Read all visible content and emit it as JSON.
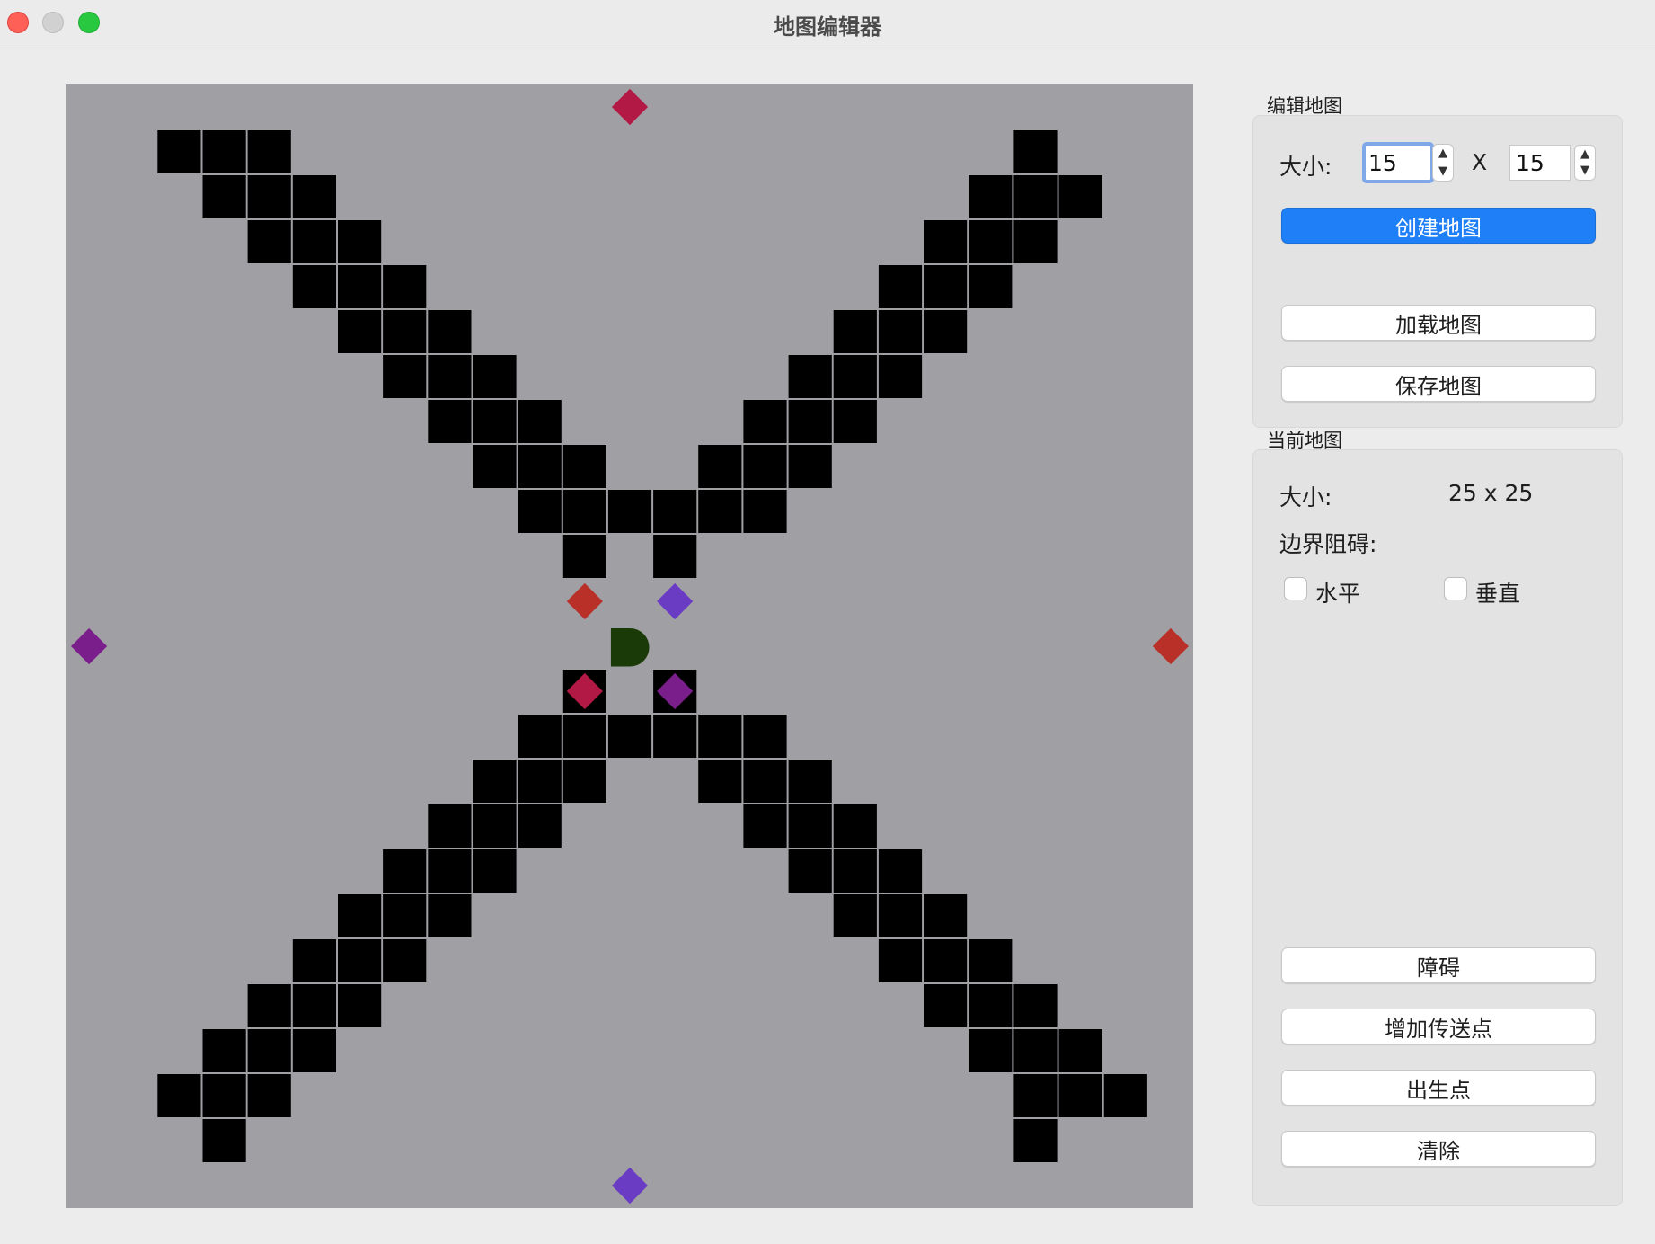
{
  "window": {
    "title": "地图编辑器"
  },
  "edit_group": {
    "label": "编辑地图",
    "size_label": "大小:",
    "width_value": "15",
    "height_value": "15",
    "separator": "X",
    "create_button": "创建地图",
    "load_button": "加载地图",
    "save_button": "保存地图"
  },
  "current_group": {
    "label": "当前地图",
    "size_label": "大小:",
    "size_value": "25 x 25",
    "border_label": "边界阻碍:",
    "horizontal_label": "水平",
    "vertical_label": "垂直",
    "horizontal_checked": false,
    "vertical_checked": false
  },
  "tools": {
    "obstacle_button": "障碍",
    "teleport_button": "增加传送点",
    "spawn_button": "出生点",
    "clear_button": "清除"
  },
  "colors": {
    "board_background": "#a09fa4",
    "obstacle": "#000000",
    "spawn": "#1a3a08",
    "teleport_crimson": "#b21a45",
    "teleport_red": "#b83028",
    "teleport_purple": "#7a1e8c",
    "teleport_violet": "#6a3cc4",
    "accent": "#1f7ff6"
  },
  "map": {
    "grid_size": 25,
    "obstacles": [
      [
        2,
        3
      ],
      [
        1,
        2
      ],
      [
        1,
        3
      ],
      [
        1,
        4
      ],
      [
        2,
        3
      ],
      [
        2,
        4
      ],
      [
        2,
        5
      ],
      [
        3,
        4
      ],
      [
        3,
        5
      ],
      [
        3,
        6
      ],
      [
        4,
        5
      ],
      [
        4,
        6
      ],
      [
        4,
        7
      ],
      [
        5,
        6
      ],
      [
        5,
        7
      ],
      [
        5,
        8
      ],
      [
        6,
        7
      ],
      [
        6,
        8
      ],
      [
        6,
        9
      ],
      [
        7,
        8
      ],
      [
        7,
        9
      ],
      [
        7,
        10
      ],
      [
        8,
        9
      ],
      [
        8,
        10
      ],
      [
        8,
        11
      ],
      [
        9,
        10
      ],
      [
        9,
        11
      ],
      [
        9,
        12
      ],
      [
        10,
        11
      ],
      [
        1,
        21
      ],
      [
        2,
        20
      ],
      [
        2,
        21
      ],
      [
        2,
        22
      ],
      [
        3,
        19
      ],
      [
        3,
        20
      ],
      [
        3,
        21
      ],
      [
        4,
        18
      ],
      [
        4,
        19
      ],
      [
        4,
        20
      ],
      [
        5,
        17
      ],
      [
        5,
        18
      ],
      [
        5,
        19
      ],
      [
        6,
        16
      ],
      [
        6,
        17
      ],
      [
        6,
        18
      ],
      [
        7,
        15
      ],
      [
        7,
        16
      ],
      [
        7,
        17
      ],
      [
        8,
        14
      ],
      [
        8,
        15
      ],
      [
        8,
        16
      ],
      [
        9,
        13
      ],
      [
        9,
        14
      ],
      [
        9,
        15
      ],
      [
        10,
        13
      ],
      [
        13,
        11
      ],
      [
        14,
        10
      ],
      [
        14,
        11
      ],
      [
        14,
        12
      ],
      [
        15,
        9
      ],
      [
        15,
        10
      ],
      [
        15,
        11
      ],
      [
        16,
        8
      ],
      [
        16,
        9
      ],
      [
        16,
        10
      ],
      [
        17,
        7
      ],
      [
        17,
        8
      ],
      [
        17,
        9
      ],
      [
        18,
        6
      ],
      [
        18,
        7
      ],
      [
        18,
        8
      ],
      [
        19,
        5
      ],
      [
        19,
        6
      ],
      [
        19,
        7
      ],
      [
        20,
        4
      ],
      [
        20,
        5
      ],
      [
        20,
        6
      ],
      [
        21,
        3
      ],
      [
        21,
        4
      ],
      [
        21,
        5
      ],
      [
        22,
        2
      ],
      [
        22,
        3
      ],
      [
        22,
        4
      ],
      [
        23,
        3
      ],
      [
        13,
        13
      ],
      [
        14,
        13
      ],
      [
        14,
        14
      ],
      [
        14,
        15
      ],
      [
        15,
        14
      ],
      [
        15,
        15
      ],
      [
        15,
        16
      ],
      [
        16,
        15
      ],
      [
        16,
        16
      ],
      [
        16,
        17
      ],
      [
        17,
        16
      ],
      [
        17,
        17
      ],
      [
        17,
        18
      ],
      [
        18,
        17
      ],
      [
        18,
        18
      ],
      [
        18,
        19
      ],
      [
        19,
        18
      ],
      [
        19,
        19
      ],
      [
        19,
        20
      ],
      [
        20,
        19
      ],
      [
        20,
        20
      ],
      [
        20,
        21
      ],
      [
        21,
        20
      ],
      [
        21,
        21
      ],
      [
        21,
        22
      ],
      [
        22,
        21
      ],
      [
        22,
        22
      ],
      [
        22,
        23
      ],
      [
        23,
        21
      ]
    ],
    "spawn": [
      12,
      12
    ],
    "teleports": [
      {
        "row": 0,
        "col": 12.5,
        "color": "teleport_crimson"
      },
      {
        "row": 11,
        "col": 11.5,
        "color": "teleport_red"
      },
      {
        "row": 11,
        "col": 13.5,
        "color": "teleport_violet"
      },
      {
        "row": 12,
        "col": 0.5,
        "color": "teleport_purple"
      },
      {
        "row": 12,
        "col": 24.5,
        "color": "teleport_red"
      },
      {
        "row": 13,
        "col": 11.5,
        "color": "teleport_crimson"
      },
      {
        "row": 13,
        "col": 13.5,
        "color": "teleport_purple"
      },
      {
        "row": 24.5,
        "col": 12.5,
        "color": "teleport_violet"
      }
    ]
  }
}
